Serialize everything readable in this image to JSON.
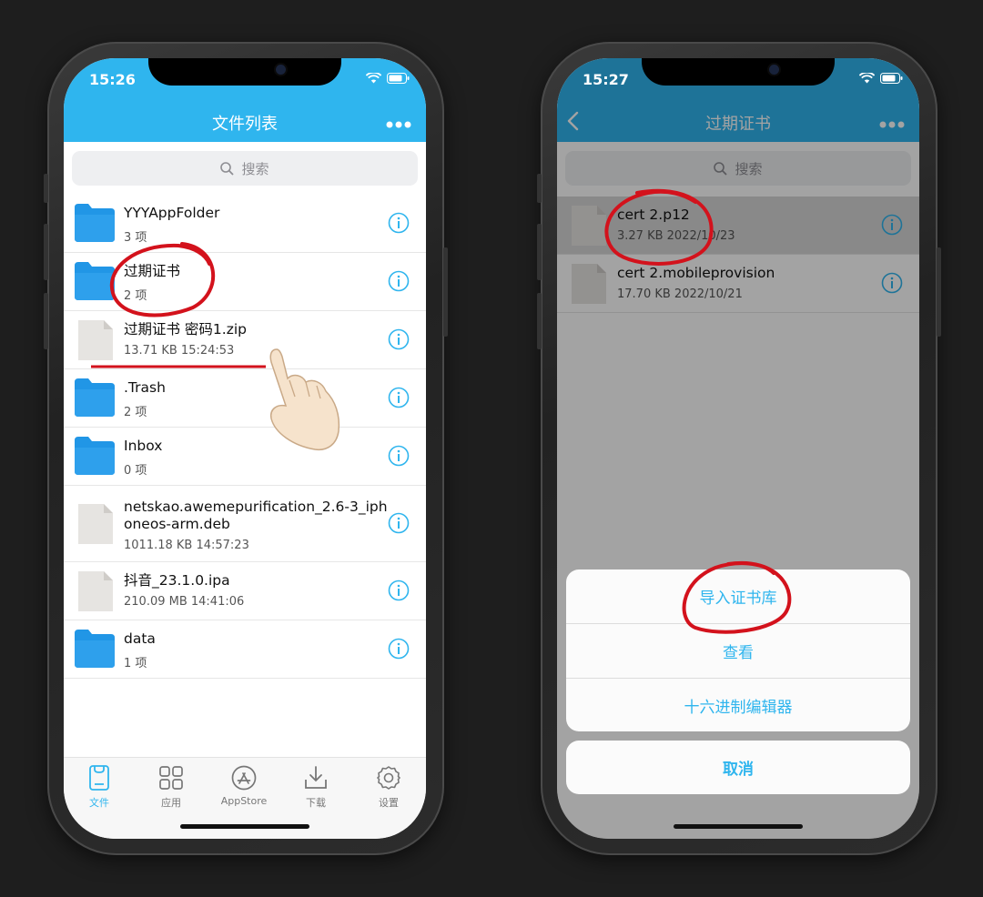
{
  "left": {
    "time": "15:26",
    "title": "文件列表",
    "search_placeholder": "搜索",
    "files": [
      {
        "name": "YYYAppFolder",
        "meta": "3 项",
        "type": "folder"
      },
      {
        "name": "过期证书",
        "meta": "2 项",
        "type": "folder"
      },
      {
        "name": "过期证书 密码1.zip",
        "meta": "13.71 KB    15:24:53",
        "type": "file"
      },
      {
        "name": ".Trash",
        "meta": "2 项",
        "type": "folder"
      },
      {
        "name": "Inbox",
        "meta": "0 项",
        "type": "folder"
      },
      {
        "name": "netskao.awemepurification_2.6-3_iph",
        "name2": "oneos-arm.deb",
        "meta": "1011.18 KB    14:57:23",
        "type": "file"
      },
      {
        "name": "抖音_23.1.0.ipa",
        "meta": "210.09 MB    14:41:06",
        "type": "file"
      },
      {
        "name": "data",
        "meta": "1 项",
        "type": "folder"
      }
    ],
    "tabs": [
      {
        "label": "文件",
        "icon": "file-tab-icon",
        "active": true
      },
      {
        "label": "应用",
        "icon": "apps-grid-icon",
        "active": false
      },
      {
        "label": "AppStore",
        "icon": "appstore-icon",
        "active": false
      },
      {
        "label": "下载",
        "icon": "download-icon",
        "active": false
      },
      {
        "label": "设置",
        "icon": "gear-icon",
        "active": false
      }
    ]
  },
  "right": {
    "time": "15:27",
    "title": "过期证书",
    "search_placeholder": "搜索",
    "files": [
      {
        "name": "cert 2.p12",
        "meta": "3.27 KB    2022/10/23",
        "type": "file",
        "selected": true
      },
      {
        "name": "cert 2.mobileprovision",
        "meta": "17.70 KB    2022/10/21",
        "type": "file",
        "selected": false
      }
    ],
    "actions": [
      "导入证书库",
      "查看",
      "十六进制编辑器"
    ],
    "cancel": "取消"
  },
  "colors": {
    "accent": "#2fb5ee",
    "folder": "#2196e6",
    "annotation": "#d3121c"
  }
}
